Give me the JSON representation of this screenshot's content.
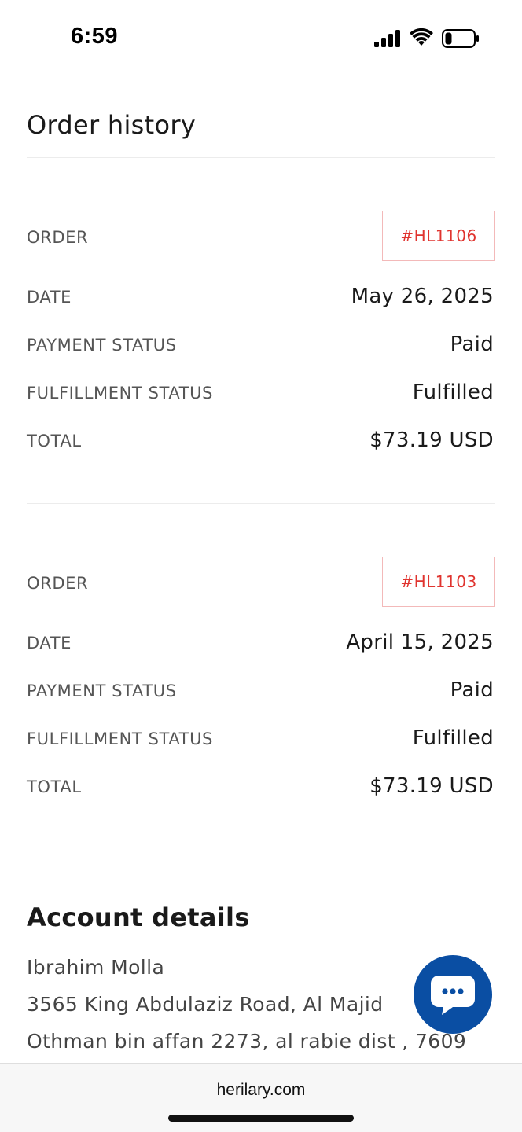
{
  "status_bar": {
    "time": "6:59",
    "icons": [
      "signal-icon",
      "wifi-icon",
      "battery-icon"
    ]
  },
  "page": {
    "title": "Order history"
  },
  "orders": [
    {
      "labels": {
        "order": "ORDER",
        "date": "DATE",
        "payment_status": "PAYMENT STATUS",
        "fulfillment_status": "FULFILLMENT STATUS",
        "total": "TOTAL"
      },
      "order_number": "#HL1106",
      "date": "May 26, 2025",
      "payment_status": "Paid",
      "fulfillment_status": "Fulfilled",
      "total": "$73.19 USD"
    },
    {
      "labels": {
        "order": "ORDER",
        "date": "DATE",
        "payment_status": "PAYMENT STATUS",
        "fulfillment_status": "FULFILLMENT STATUS",
        "total": "TOTAL"
      },
      "order_number": "#HL1103",
      "date": "April 15, 2025",
      "payment_status": "Paid",
      "fulfillment_status": "Fulfilled",
      "total": "$73.19 USD"
    }
  ],
  "account": {
    "title": "Account details",
    "name": "Ibrahim Molla",
    "address_line1": "3565 King Abdulaziz Road, Al Majid",
    "address_line2": "Othman bin affan 2273, al rabie dist , 7609"
  },
  "chat": {
    "icon": "chat-bubble-icon"
  },
  "browser": {
    "url": "herilary.com"
  },
  "colors": {
    "accent_red": "#e0342f",
    "badge_border": "#f3b9b9",
    "chat_blue": "#0a4ea3"
  }
}
